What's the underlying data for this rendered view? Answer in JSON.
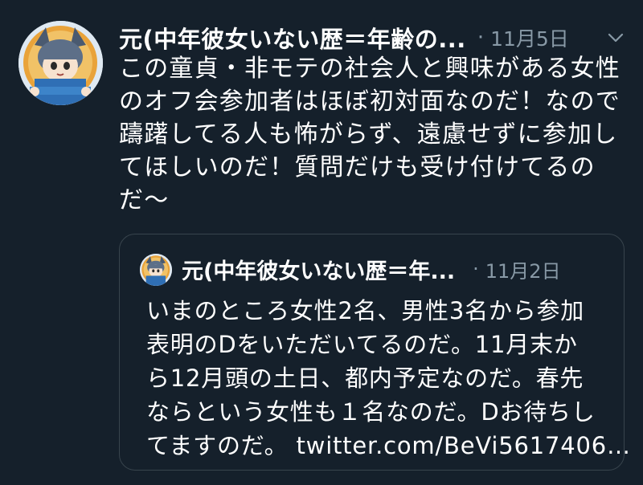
{
  "tweet": {
    "author_name": "元(中年彼女いない歴＝年齢の...",
    "separator": "·",
    "date": "11月5日",
    "menu_icon": "chevron-down-icon",
    "text_lines": [
      "この童貞・非モテの社会人と興味がある女性",
      "のオフ会参加者はほぼ初対面なのだ！なので",
      "躊躇してる人も怖がらず、遠慮せずに参加し",
      "てほしいのだ！質問だけも受け付けてるの",
      "だ〜"
    ]
  },
  "quoted_tweet": {
    "author_name": "元(中年彼女いない歴＝年...",
    "separator": "·",
    "date": "11月2日",
    "text_lines": [
      "いまのところ女性2名、男性3名から参加",
      "表明のDをいただいてるのだ。11月末か",
      "ら12月頭の土日、都内予定なのだ。春先",
      "ならという女性も１名なのだ。Dお待ちし"
    ],
    "last_line_text": "てますのだ。",
    "link_text": "twitter.com/BeVi5617406…"
  },
  "colors": {
    "background": "#15202b",
    "text": "#ffffff",
    "secondary_text": "#8899a6",
    "border": "#38444d"
  }
}
